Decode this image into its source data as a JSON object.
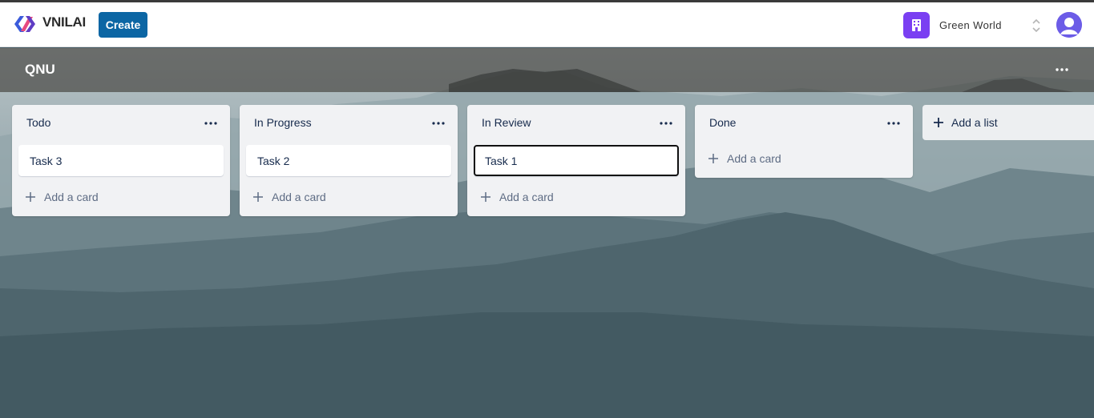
{
  "app": {
    "brand": "VNILAI",
    "create_label": "Create",
    "workspace_name": "Green World",
    "brand_color": "#0c66a4",
    "workspace_color": "#7a3ff2"
  },
  "board": {
    "title": "QNU",
    "menu_icon": "ellipsis-icon",
    "lists": [
      {
        "title": "Todo",
        "cards": [
          "Task 3"
        ],
        "add_label": "Add a card"
      },
      {
        "title": "In Progress",
        "cards": [
          "Task 2"
        ],
        "add_label": "Add a card"
      },
      {
        "title": "In Review",
        "cards": [
          "Task 1"
        ],
        "add_label": "Add a card",
        "selected_card": "Task 1"
      },
      {
        "title": "Done",
        "cards": [],
        "add_label": "Add a card"
      }
    ],
    "add_list_label": "Add a list"
  }
}
